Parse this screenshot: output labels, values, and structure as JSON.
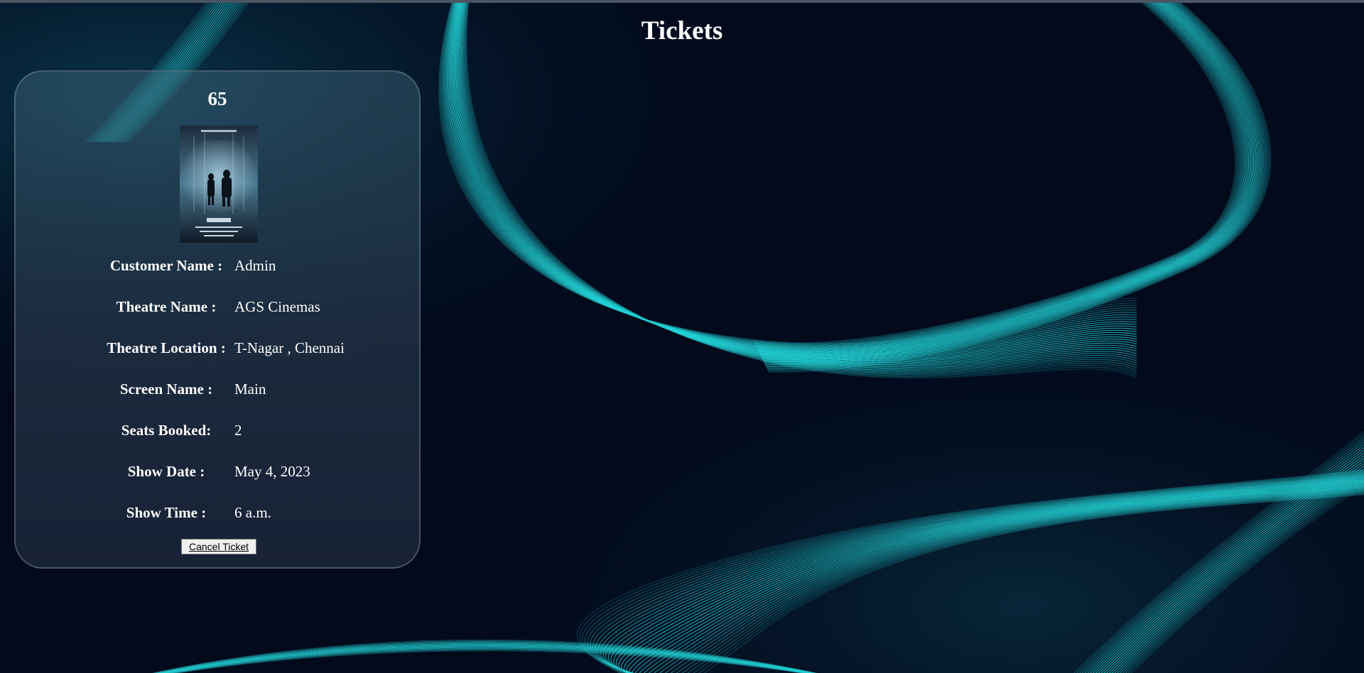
{
  "page": {
    "title": "Tickets"
  },
  "ticket": {
    "id": "65",
    "poster_icon": "movie-poster-image",
    "fields": [
      {
        "label": "Customer Name :",
        "value": "Admin"
      },
      {
        "label": "Theatre Name :",
        "value": "AGS Cinemas"
      },
      {
        "label": "Theatre Location :",
        "value": "T-Nagar , Chennai"
      },
      {
        "label": "Screen Name :",
        "value": "Main"
      },
      {
        "label": "Seats Booked:",
        "value": "2"
      },
      {
        "label": "Show Date :",
        "value": "May 4, 2023"
      },
      {
        "label": "Show Time :",
        "value": "6 a.m."
      }
    ],
    "cancel_label": "Cancel Ticket"
  },
  "colors": {
    "background": "#020a1c",
    "accent": "#22d3d6",
    "text": "#ffffff"
  }
}
